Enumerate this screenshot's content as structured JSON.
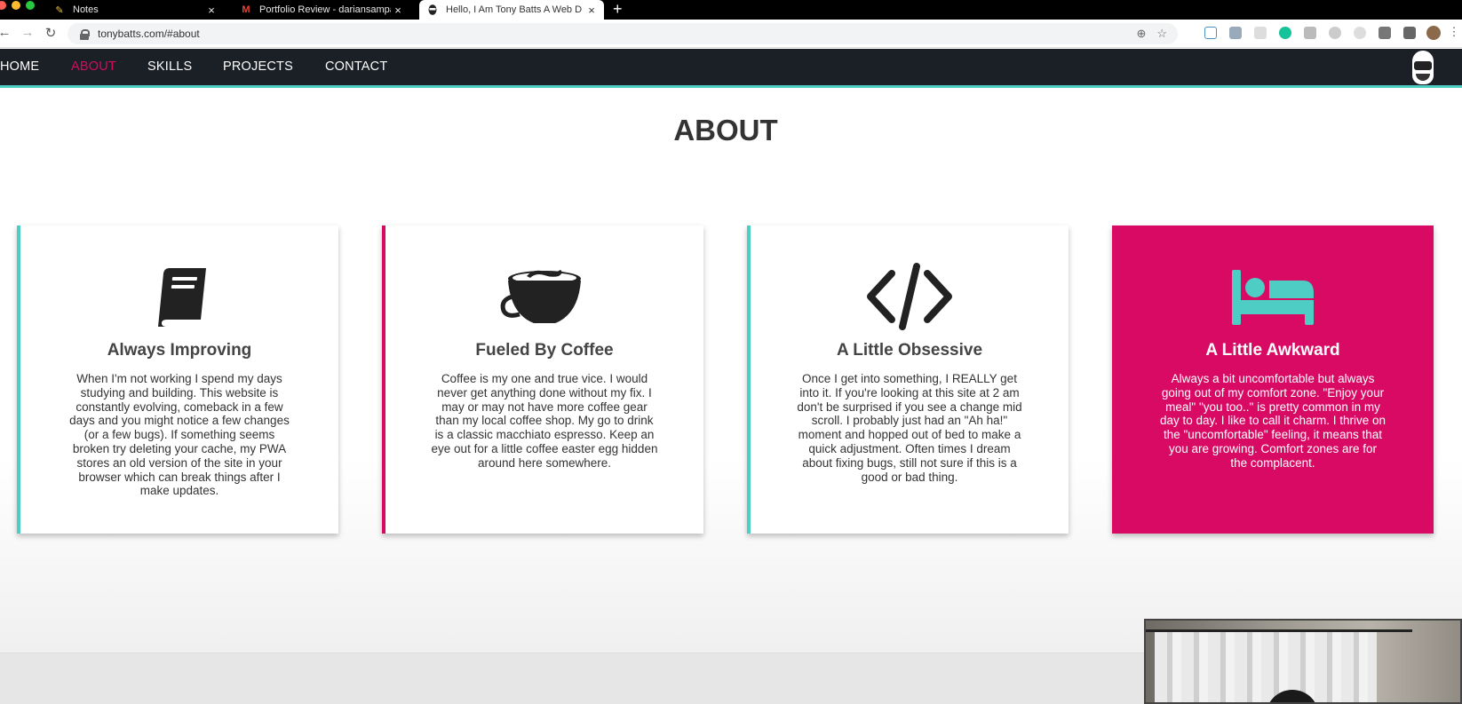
{
  "browser": {
    "tabs": [
      {
        "title": "Notes",
        "icon": "pencil-icon"
      },
      {
        "title": "Portfolio Review - dariansampa",
        "icon": "gmail-icon"
      },
      {
        "title": "Hello, I Am Tony Batts A Web D",
        "icon": "site-avatar-icon"
      }
    ],
    "url": "tonybatts.com/#about"
  },
  "nav": {
    "items": [
      {
        "label": "HOME"
      },
      {
        "label": "ABOUT",
        "active": true
      },
      {
        "label": "SKILLS"
      },
      {
        "label": "PROJECTS"
      },
      {
        "label": "CONTACT"
      }
    ]
  },
  "about": {
    "title": "ABOUT",
    "cards": [
      {
        "icon": "book-icon",
        "title": "Always Improving",
        "text": "When I'm not working I spend my days studying and building. This website is constantly evolving, comeback in a few days and you might notice a few changes (or a few bugs). If something seems broken try deleting your cache, my PWA stores an old version of the site in your browser which can break things after I make updates."
      },
      {
        "icon": "coffee-cup-icon",
        "title": "Fueled By Coffee",
        "text": "Coffee is my one and true vice. I would never get anything done without my fix. I may or may not have more coffee gear than my local coffee shop. My go to drink is a classic macchiato espresso. Keep an eye out for a little coffee easter egg hidden around here somewhere."
      },
      {
        "icon": "code-icon",
        "title": "A Little Obsessive",
        "text": "Once I get into something, I REALLY get into it. If you're looking at this site at 2 am don't be surprised if you see a change mid scroll. I probably just had an \"Ah ha!\" moment and hopped out of bed to make a quick adjustment. Often times I dream about fixing bugs, still not sure if this is a good or bad thing."
      },
      {
        "icon": "bed-icon",
        "title": "A Little Awkward",
        "text": "Always a bit uncomfortable but always going out of my comfort zone. \"Enjoy your meal\" \"you too..\" is pretty common in my day to day. I like to call it charm. I thrive on the \"uncomfortable\" feeling, it means that you are growing. Comfort zones are for the complacent."
      }
    ]
  },
  "colors": {
    "accent_teal": "#4ecdc4",
    "accent_pink": "#d80a63",
    "nav_bg": "#1b1f26"
  }
}
